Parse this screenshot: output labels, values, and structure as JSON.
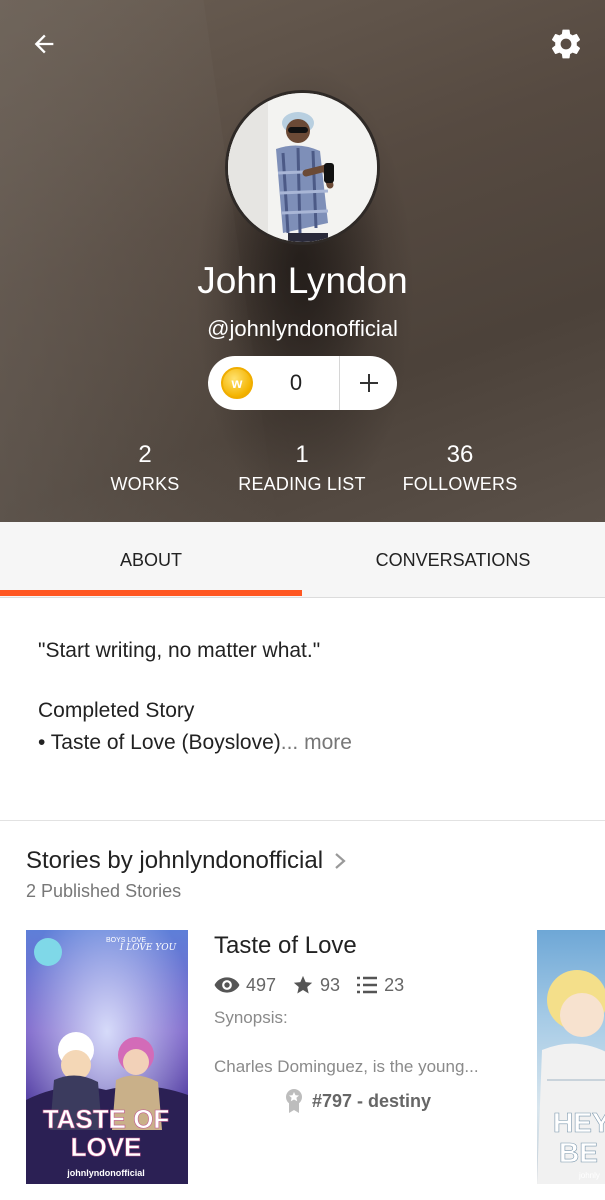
{
  "header": {
    "name": "John Lyndon",
    "handle": "@johnlyndonofficial",
    "coins": "0",
    "coin_icon": "wattpad-coin-icon",
    "stats": [
      {
        "value": "2",
        "label": "WORKS"
      },
      {
        "value": "1",
        "label": "READING LIST"
      },
      {
        "value": "36",
        "label": "FOLLOWERS"
      }
    ]
  },
  "tabs": [
    {
      "label": "ABOUT",
      "active": true
    },
    {
      "label": "CONVERSATIONS",
      "active": false
    }
  ],
  "about": {
    "quote": "\"Start writing, no matter what.\"",
    "heading": "Completed Story",
    "bullet": "• Taste of Love (Boyslove)",
    "more": "... more"
  },
  "stories": {
    "title": "Stories by johnlyndonofficial",
    "subtitle": "2 Published Stories",
    "items": [
      {
        "title": "Taste of Love",
        "reads": "497",
        "votes": "93",
        "parts": "23",
        "synopsis_label": "Synopsis:",
        "synopsis": "Charles Dominguez, is the young...",
        "rank": "#797 - destiny",
        "cover": {
          "line1": "TASTE OF",
          "line2": "LOVE",
          "top": "BOYS LOVE",
          "script": "I LOVE YOU",
          "author": "johnlyndonofficial"
        }
      },
      {
        "cover": {
          "line1": "HEY",
          "line2": "BE",
          "author": "johnly"
        }
      }
    ]
  },
  "colors": {
    "accent": "#ff5722",
    "coin": "#f4b400",
    "tab_bg": "#f6f6f6"
  }
}
